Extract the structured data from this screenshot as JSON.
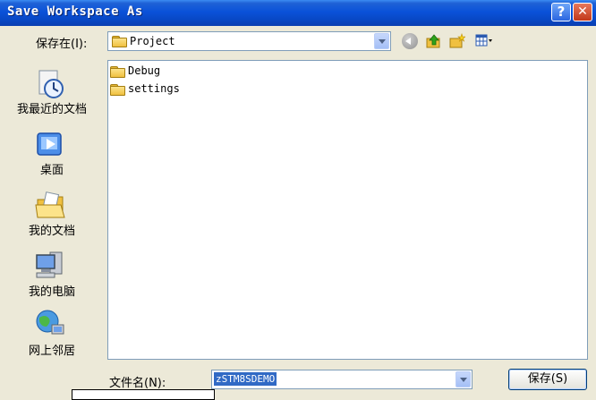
{
  "window": {
    "title": "Save Workspace As",
    "help_label": "?",
    "close_label": "✕"
  },
  "toolbar": {
    "lookin_label": "保存在(I):",
    "lookin_value": "Project",
    "icons": [
      "back-icon",
      "up-folder-icon",
      "new-folder-icon",
      "view-menu-icon"
    ]
  },
  "places": [
    {
      "label": "我最近的文档",
      "icon": "recent-documents-icon"
    },
    {
      "label": "桌面",
      "icon": "desktop-icon"
    },
    {
      "label": "我的文档",
      "icon": "my-documents-icon"
    },
    {
      "label": "我的电脑",
      "icon": "my-computer-icon"
    },
    {
      "label": "网上邻居",
      "icon": "network-places-icon"
    }
  ],
  "files": [
    {
      "name": "Debug",
      "icon": "folder-icon"
    },
    {
      "name": "settings",
      "icon": "folder-icon"
    }
  ],
  "filename": {
    "label": "文件名(N):",
    "value": "zSTM8SDEMO"
  },
  "save_button": {
    "label": "保存(S)"
  },
  "colors": {
    "titlebar": "#0A52D9",
    "dialog_bg": "#ECE9D8",
    "selection": "#316AC5",
    "border": "#7F9DB9"
  }
}
